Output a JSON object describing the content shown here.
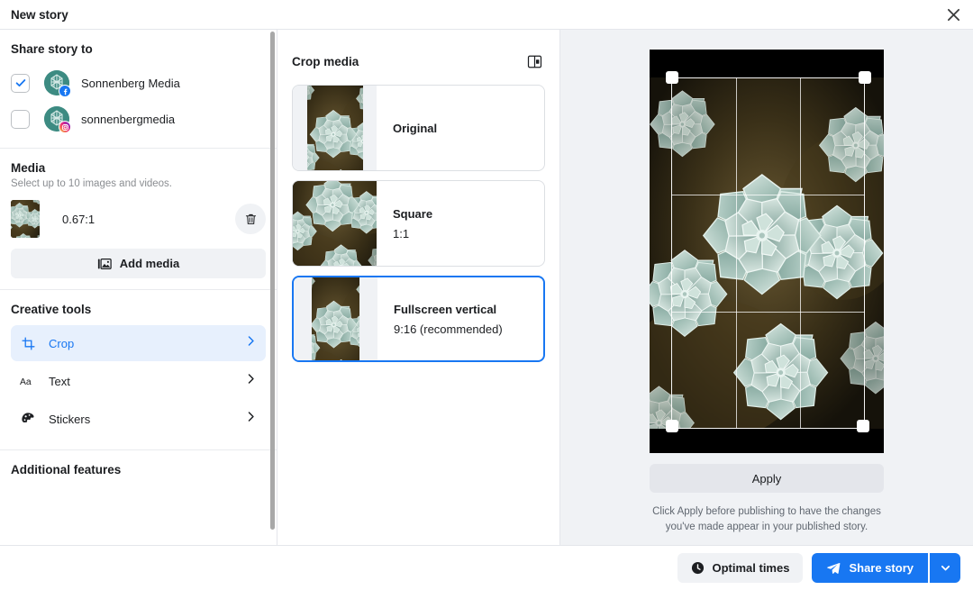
{
  "header": {
    "title": "New story",
    "close_icon": "close-icon"
  },
  "share": {
    "section_title": "Share story to",
    "accounts": [
      {
        "name": "Sonnenberg Media",
        "platform": "facebook",
        "checked": true
      },
      {
        "name": "sonnenbergmedia",
        "platform": "instagram",
        "checked": false
      }
    ]
  },
  "media": {
    "section_title": "Media",
    "subtitle": "Select up to 10 images and videos.",
    "items": [
      {
        "ratio": "0.67:1",
        "delete_icon": "trash-icon"
      }
    ],
    "add_label": "Add media",
    "add_icon": "image-icon"
  },
  "creative_tools": {
    "section_title": "Creative tools",
    "items": [
      {
        "label": "Crop",
        "icon": "crop-icon",
        "active": true
      },
      {
        "label": "Text",
        "icon": "text-icon",
        "active": false
      },
      {
        "label": "Stickers",
        "icon": "sticker-icon",
        "active": false
      }
    ]
  },
  "additional": {
    "section_title": "Additional features"
  },
  "crop_panel": {
    "title": "Crop media",
    "collapse_icon": "panel-collapse-icon",
    "options": [
      {
        "name": "Original",
        "ratio": "",
        "selected": false,
        "aspect": "0.67"
      },
      {
        "name": "Square",
        "ratio": "1:1",
        "selected": false,
        "aspect": "1"
      },
      {
        "name": "Fullscreen vertical",
        "ratio": "9:16 (recommended)",
        "selected": true,
        "aspect": "0.5625"
      }
    ]
  },
  "preview": {
    "apply_label": "Apply",
    "hint": "Click Apply before publishing to have the changes you've made appear in your published story.",
    "handles": 4
  },
  "bottom": {
    "optimal_label": "Optimal times",
    "optimal_icon": "clock-icon",
    "share_label": "Share story",
    "share_icon": "send-icon",
    "caret_icon": "chevron-down-icon"
  },
  "colors": {
    "accent": "#1877f2",
    "accent_soft": "#e7f0fd",
    "surface": "#f0f2f5",
    "text": "#1c1e21",
    "muted": "#8a8d91"
  }
}
